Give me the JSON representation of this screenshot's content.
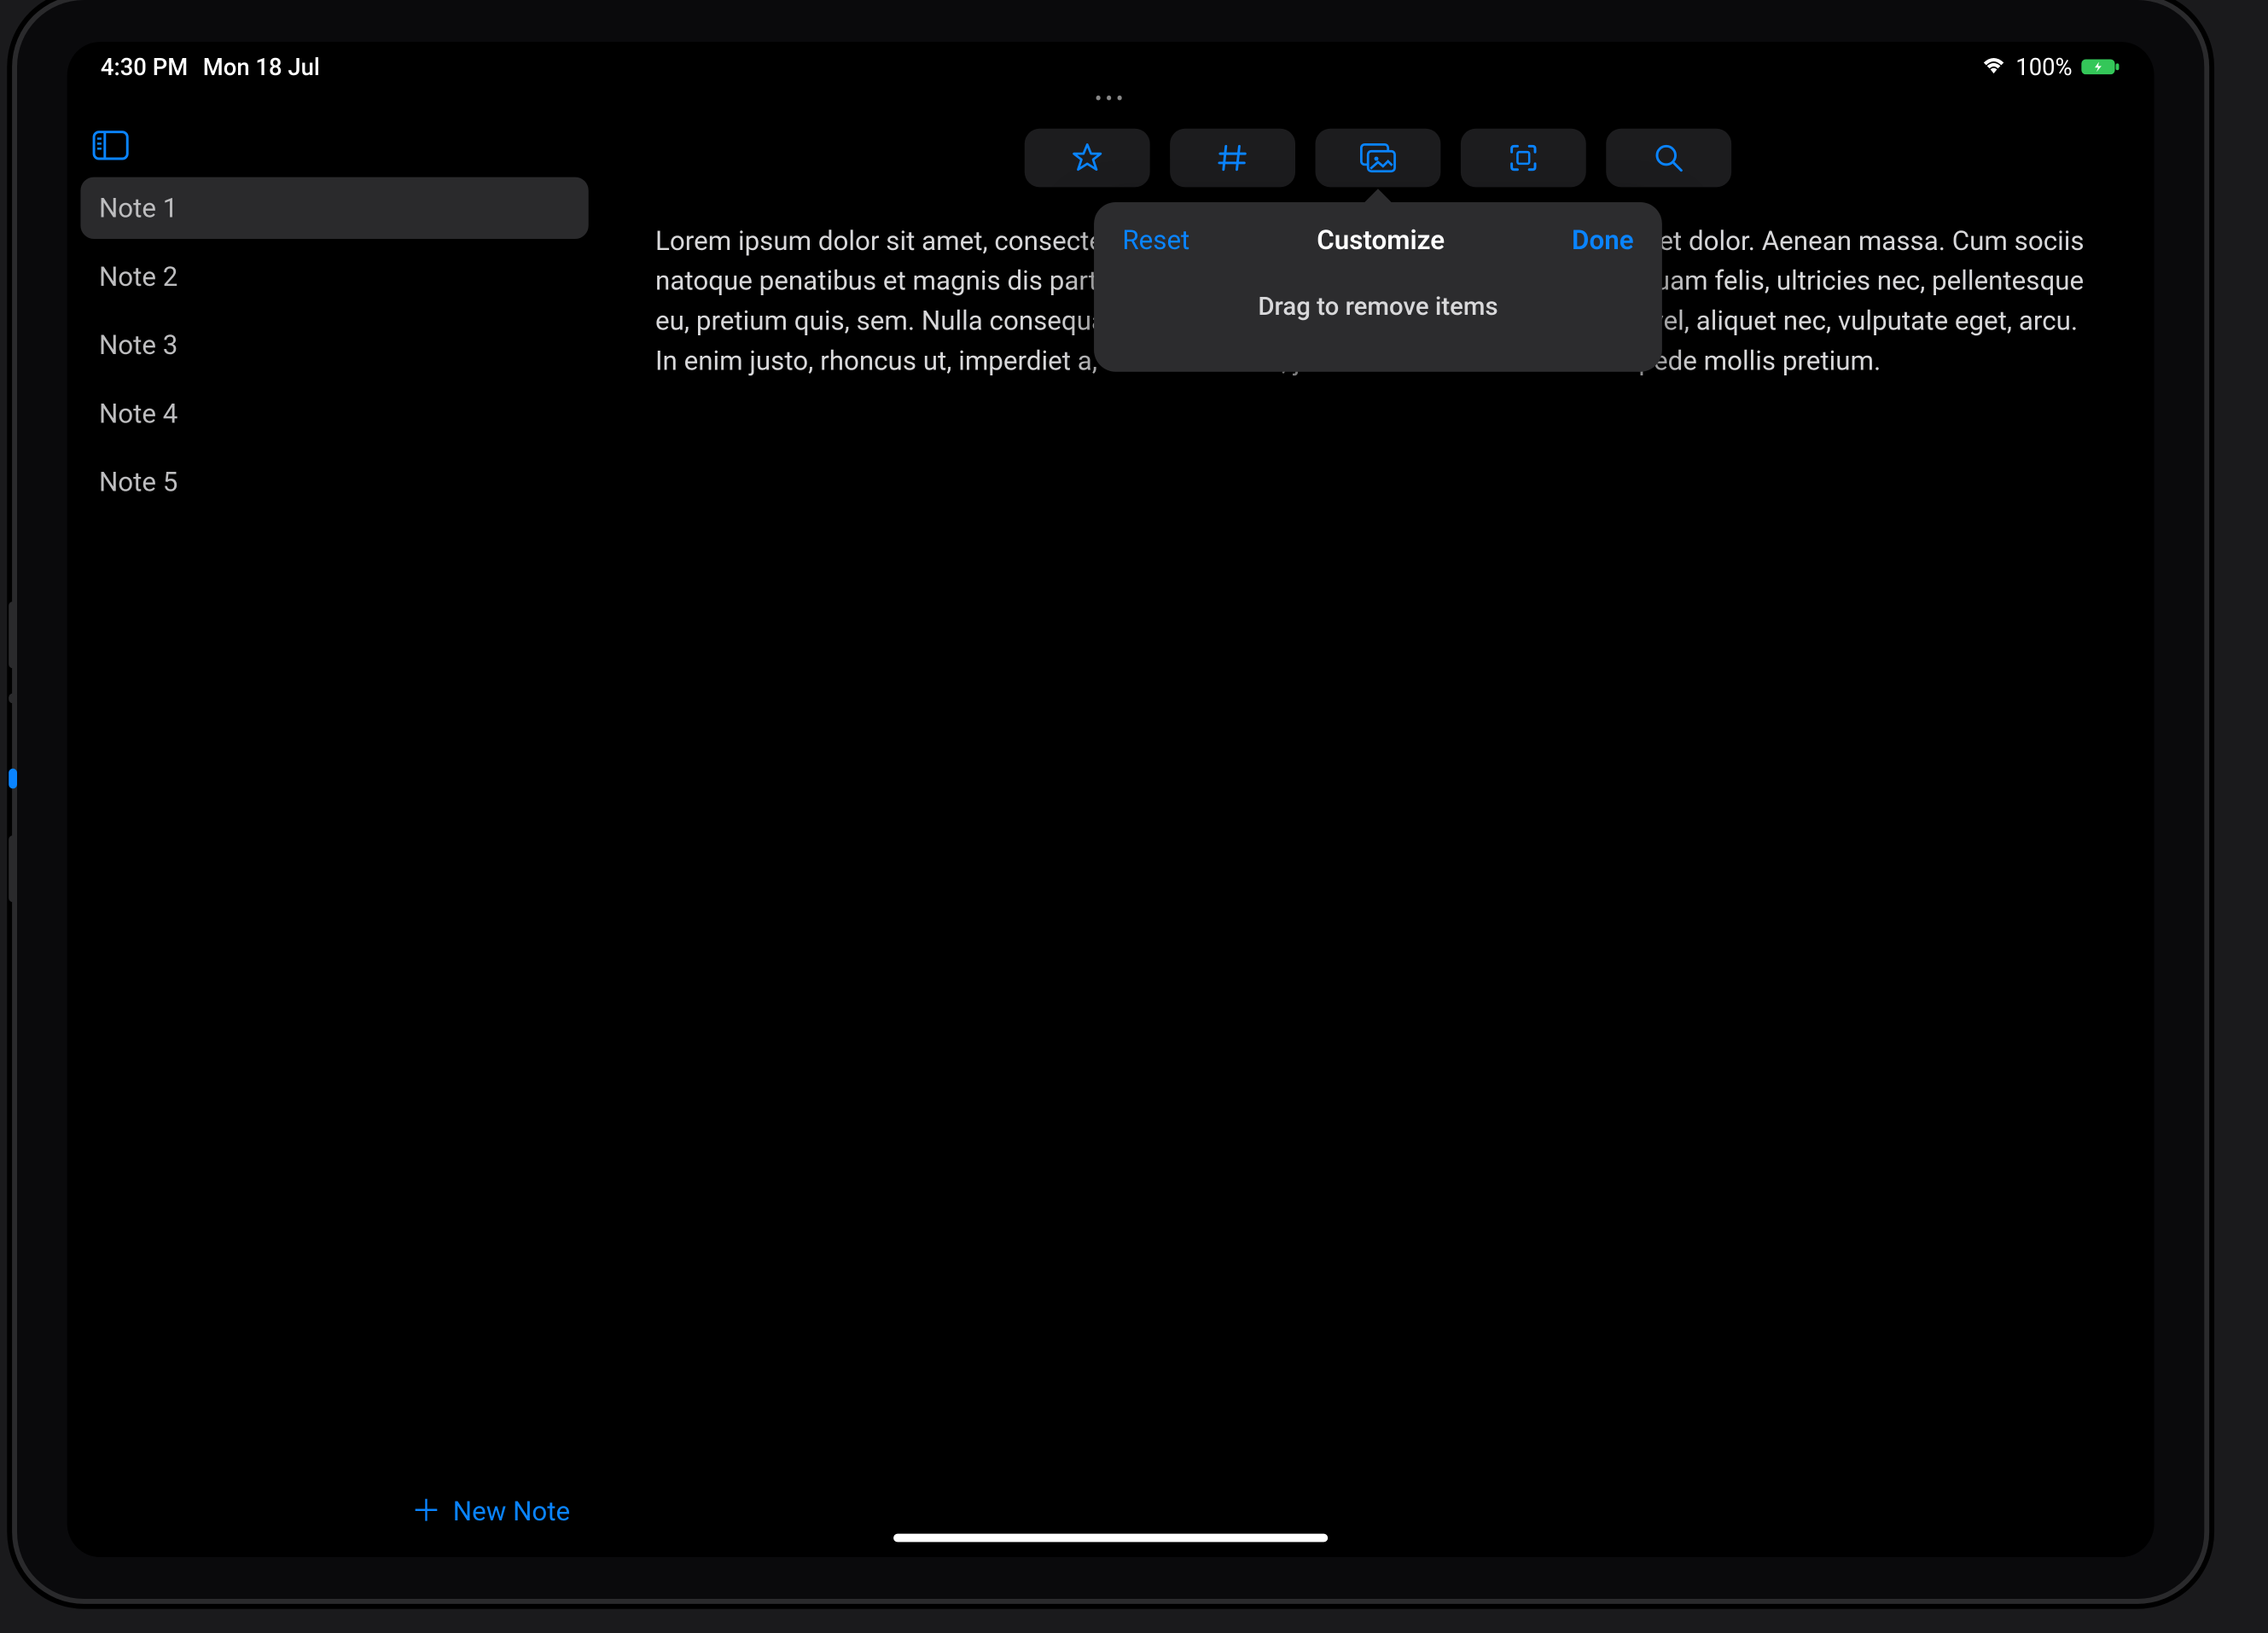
{
  "status": {
    "time": "4:30 PM",
    "date": "Mon 18 Jul",
    "battery_pct": "100%"
  },
  "sidebar": {
    "notes": [
      {
        "title": "Note 1",
        "selected": true
      },
      {
        "title": "Note 2",
        "selected": false
      },
      {
        "title": "Note 3",
        "selected": false
      },
      {
        "title": "Note 4",
        "selected": false
      },
      {
        "title": "Note 5",
        "selected": false
      }
    ],
    "new_note_label": "New Note"
  },
  "toolbar": {
    "items": [
      {
        "name": "favorite",
        "icon": "star"
      },
      {
        "name": "tag",
        "icon": "hash"
      },
      {
        "name": "gallery",
        "icon": "images"
      },
      {
        "name": "scan",
        "icon": "scan"
      },
      {
        "name": "search",
        "icon": "search"
      }
    ]
  },
  "note": {
    "body": "Lorem ipsum dolor sit amet, consectetuer adipiscing elit. Aenean commodo ligula eget dolor. Aenean massa. Cum sociis natoque penatibus et magnis dis parturient montes, nascetur ridiculus mus. Donec quam felis, ultricies nec, pellentesque eu, pretium quis, sem. Nulla consequat massa quis enim. Donec pede justo, fringilla vel, aliquet nec, vulputate eget, arcu. In enim justo, rhoncus ut, imperdiet a, venenatis vitae, justo. Nullam dictum felis eu pede mollis pretium."
  },
  "popover": {
    "reset": "Reset",
    "title": "Customize",
    "done": "Done",
    "hint": "Drag to remove items"
  },
  "colors": {
    "accent": "#0a84ff",
    "panel": "#1c1c1e",
    "popover": "#2c2c2e"
  }
}
